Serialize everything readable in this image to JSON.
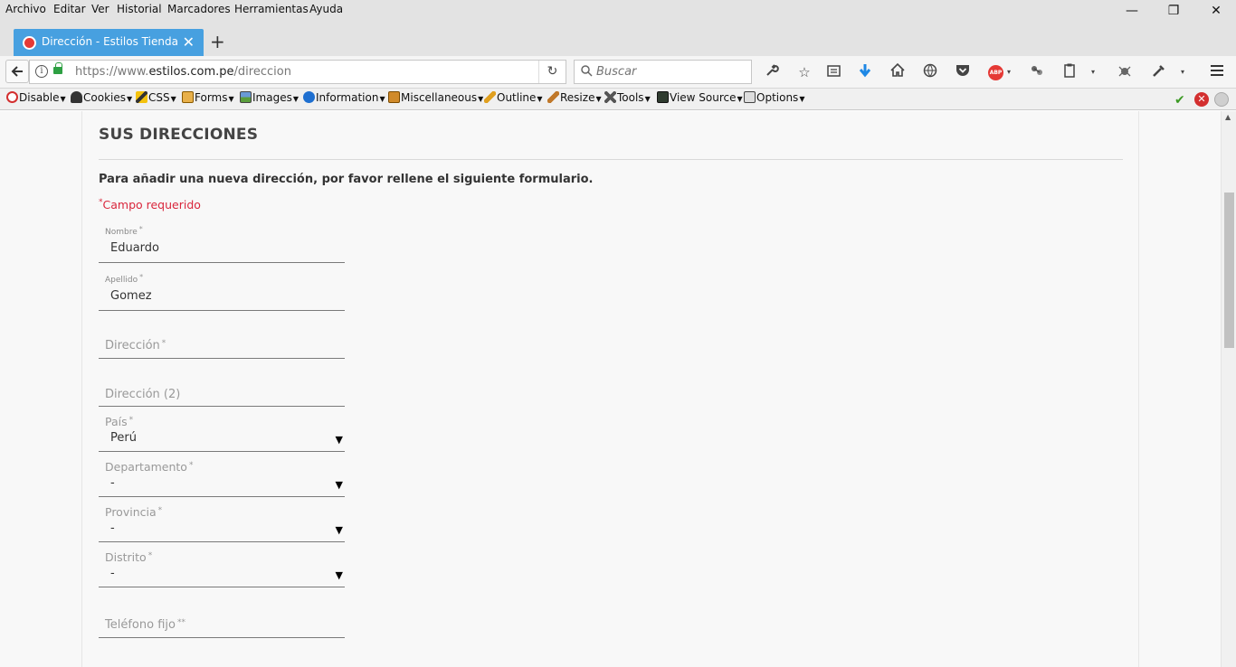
{
  "menubar": {
    "items": [
      "Archivo",
      "Editar",
      "Ver",
      "Historial",
      "Marcadores",
      "Herramientas",
      "Ayuda"
    ],
    "window_controls": [
      "—",
      "❐",
      "✕"
    ]
  },
  "tab": {
    "title": "Dirección - Estilos Tienda ...",
    "close": "✕",
    "new_tab": "+"
  },
  "navbar": {
    "url_prefix": "https://www.",
    "url_host": "estilos.com.pe",
    "url_path": "/direccion",
    "search_placeholder": "Buscar",
    "abp_label": "ABP"
  },
  "devbar": {
    "items": [
      "Disable",
      "Cookies",
      "CSS",
      "Forms",
      "Images",
      "Information",
      "Miscellaneous",
      "Outline",
      "Resize",
      "Tools",
      "View Source",
      "Options"
    ]
  },
  "page": {
    "title": "SUS DIRECCIONES",
    "intro": "Para añadir una nueva dirección, por favor rellene el siguiente formulario.",
    "required_mark": "*",
    "required_text": "Campo requerido"
  },
  "form": {
    "nombre": {
      "label": "Nombre",
      "star": "*",
      "value": "Eduardo"
    },
    "apellido": {
      "label": "Apellido",
      "star": "*",
      "value": "Gomez"
    },
    "direccion": {
      "label": "Dirección",
      "star": "*",
      "value": ""
    },
    "direccion2": {
      "label": "Dirección (2)",
      "value": ""
    },
    "pais": {
      "label": "País",
      "star": "*",
      "value": "Perú"
    },
    "departamento": {
      "label": "Departamento",
      "star": "*",
      "value": "-"
    },
    "provincia": {
      "label": "Provincia",
      "star": "*",
      "value": "-"
    },
    "distrito": {
      "label": "Distrito",
      "star": "*",
      "value": "-"
    },
    "telefono": {
      "label": "Teléfono fijo",
      "star": "**",
      "value": ""
    }
  }
}
